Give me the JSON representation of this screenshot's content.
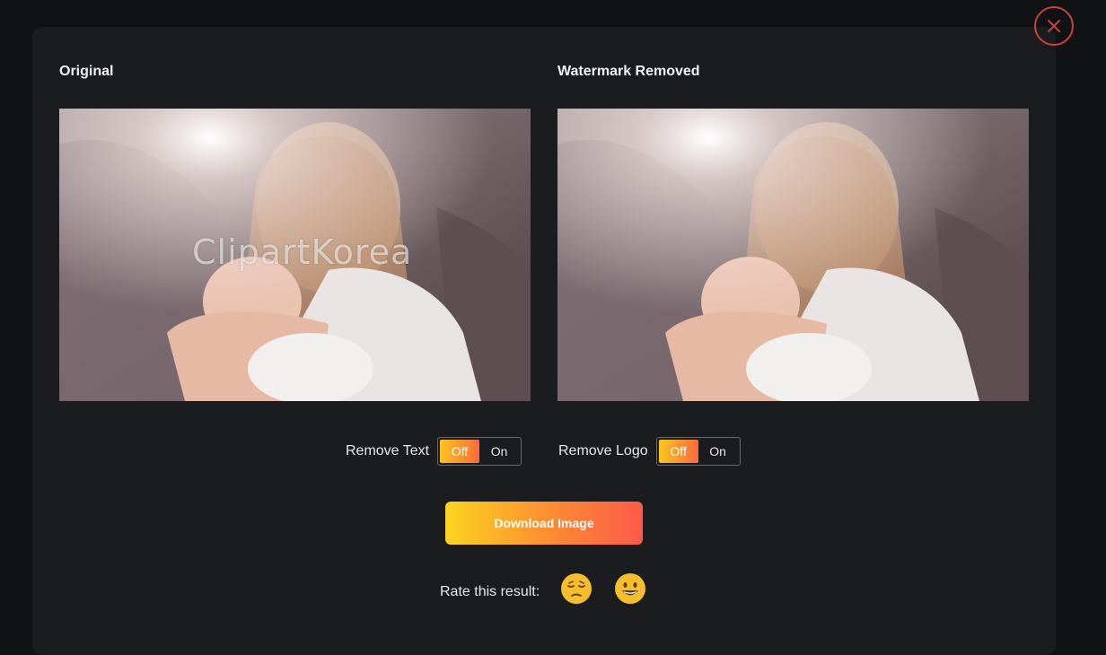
{
  "columns": {
    "original_title": "Original",
    "removed_title": "Watermark Removed"
  },
  "watermark_text": "ClipartKorea",
  "toggles": [
    {
      "label": "Remove Text",
      "off_label": "Off",
      "on_label": "On",
      "selected": "Off"
    },
    {
      "label": "Remove Logo",
      "off_label": "Off",
      "on_label": "On",
      "selected": "Off"
    }
  ],
  "download_label": "Download Image",
  "rating": {
    "label": "Rate this result:",
    "options": [
      "sad-face-icon",
      "smile-face-icon"
    ]
  },
  "icons": {
    "close": "close-icon"
  },
  "colors": {
    "accent_start": "#f9c51f",
    "accent_end": "#fc5a4a",
    "close": "#c8423a",
    "background": "#111214",
    "panel": "#1b1c1f"
  }
}
